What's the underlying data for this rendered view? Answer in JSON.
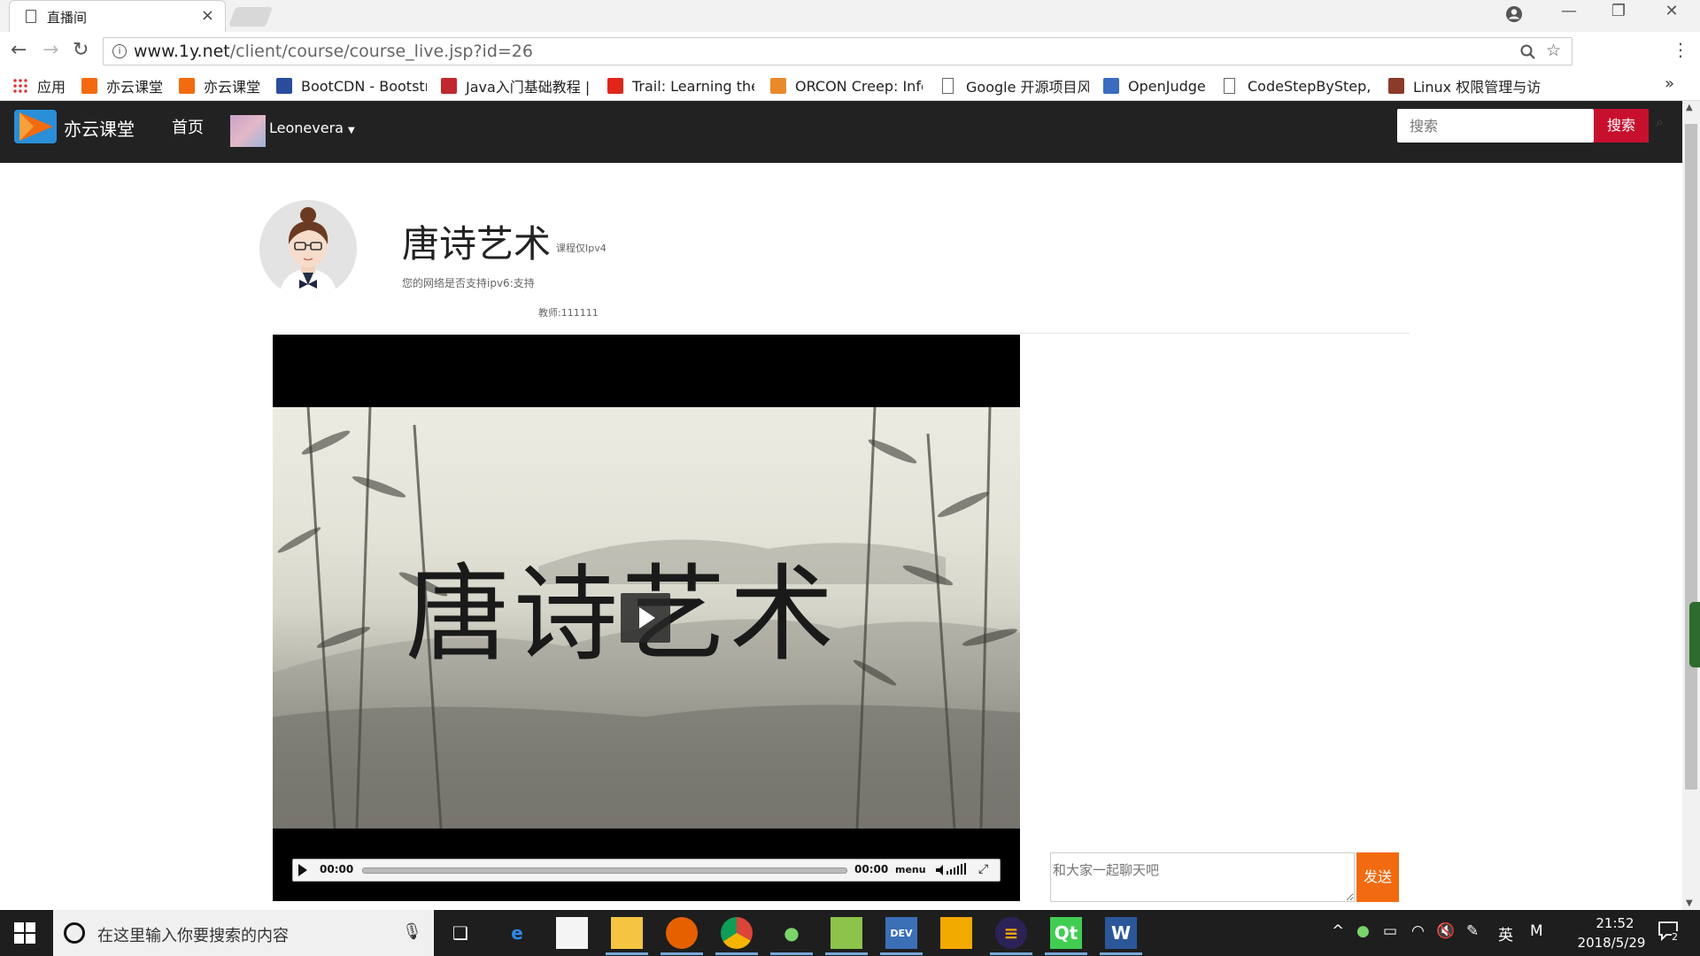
{
  "browser": {
    "tab_title": "直播间",
    "tab_close": "×",
    "url_host": "www.1y.net",
    "url_path": "/client/course/course_live.jsp?id=26",
    "bookmarks": [
      {
        "label": "应用",
        "icon": "apps-grid-icon",
        "color": "#d33"
      },
      {
        "label": "亦云课堂",
        "icon": "yiyun-logo-icon",
        "color": "#f26b11"
      },
      {
        "label": "亦云课堂",
        "icon": "yiyun-logo-icon",
        "color": "#f26b11"
      },
      {
        "label": "BootCDN - Bootstr",
        "icon": "bootcdn-icon",
        "color": "#2a4d9b"
      },
      {
        "label": "Java入门基础教程 |",
        "icon": "java-bookmark-icon",
        "color": "#c0282e"
      },
      {
        "label": "Trail: Learning the",
        "icon": "oracle-icon",
        "color": "#e0261b"
      },
      {
        "label": "ORCON Creep: Info",
        "icon": "orcon-icon",
        "color": "#e88a2c"
      },
      {
        "label": "Google 开源项目风",
        "icon": "page-icon",
        "color": "#666"
      },
      {
        "label": "OpenJudge",
        "icon": "poj-icon",
        "color": "#3a6cc0"
      },
      {
        "label": "CodeStepByStep, a",
        "icon": "page-icon",
        "color": "#666"
      },
      {
        "label": "Linux 权限管理与访",
        "icon": "linux-bookmark-icon",
        "color": "#8a3b2a"
      }
    ],
    "bookmarks_more": "»"
  },
  "site": {
    "name": "亦云课堂",
    "nav_home": "首页",
    "user_name": "Leonevera",
    "search_placeholder": "搜索",
    "search_button": "搜索",
    "brand_color": "#c7102e",
    "logo_color": "#f26b11"
  },
  "course": {
    "title": "唐诗艺术",
    "note": "课程仅Ipv4",
    "net_check": "您的网络是否支持ipv6:支持",
    "teacher": "教师:111111"
  },
  "player": {
    "video_caption": "唐诗艺术",
    "current_time": "00:00",
    "duration": "00:00",
    "menu_label": "menu",
    "progress": 0
  },
  "chat": {
    "placeholder": "和大家一起聊天吧",
    "send_label": "发送",
    "send_color": "#f26b11"
  },
  "taskbar": {
    "search_placeholder": "在这里输入你要搜索的内容",
    "apps": [
      "task-view",
      "edge",
      "sticky-notes",
      "file-explorer",
      "firefox",
      "chrome",
      "wechat",
      "notepad-plus",
      "dev-cpp",
      "app-square",
      "eclipse",
      "qt-creator",
      "word"
    ],
    "ime_label": "英",
    "ime_mode": "M",
    "time": "21:52",
    "date": "2018/5/29",
    "notification_count": "2"
  }
}
